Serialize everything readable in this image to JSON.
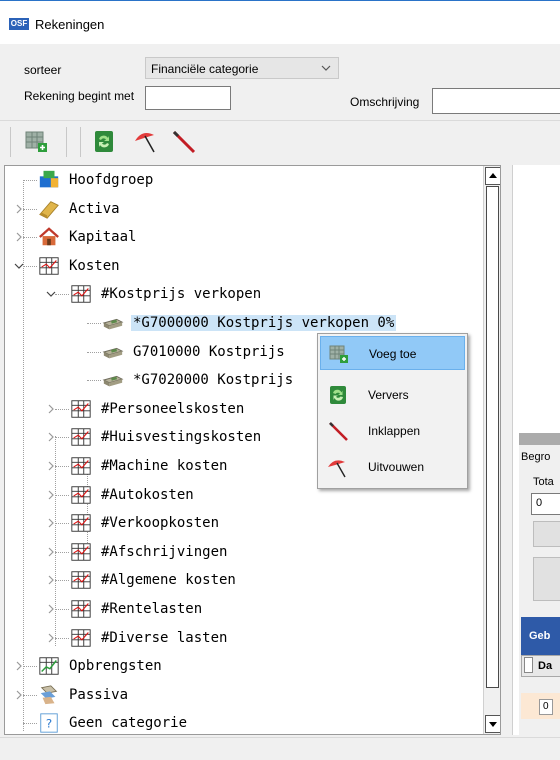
{
  "window": {
    "title": "Rekeningen",
    "app_icon_text": "OSF"
  },
  "filters": {
    "sort_label": "sorteer",
    "sort_value": "Financiële categorie",
    "start_label": "Rekening begint met",
    "start_value": "",
    "desc_label": "Omschrijving",
    "desc_value": ""
  },
  "toolbar": {
    "items": [
      {
        "name": "add-account-icon"
      },
      {
        "name": "refresh-icon"
      },
      {
        "name": "expand-umbrella-icon"
      },
      {
        "name": "collapse-icon"
      }
    ]
  },
  "tree": {
    "nodes": [
      {
        "label": "Hoofdgroep",
        "level": 0,
        "expander": "none",
        "icon": "hoofdgroep-icon"
      },
      {
        "label": "Activa",
        "level": 0,
        "expander": "collapsed",
        "icon": "gold-bar-icon"
      },
      {
        "label": "Kapitaal",
        "level": 0,
        "expander": "collapsed",
        "icon": "house-icon"
      },
      {
        "label": "Kosten",
        "level": 0,
        "expander": "expanded",
        "icon": "chart-table-icon"
      },
      {
        "label": "#Kostprijs verkopen",
        "level": 1,
        "expander": "expanded",
        "icon": "chart-table-icon"
      },
      {
        "label": "*G7000000 Kostprijs verkopen 0%",
        "level": 2,
        "expander": "none",
        "icon": "money-stack-icon",
        "selected": true
      },
      {
        "label": "G7010000 Kostprijs",
        "level": 2,
        "expander": "none",
        "icon": "money-stack-icon"
      },
      {
        "label": "*G7020000 Kostprijs",
        "level": 2,
        "expander": "none",
        "icon": "money-stack-icon"
      },
      {
        "label": "#Personeelskosten",
        "level": 1,
        "expander": "collapsed",
        "icon": "chart-table-icon"
      },
      {
        "label": "#Huisvestingskosten",
        "level": 1,
        "expander": "collapsed",
        "icon": "chart-table-icon"
      },
      {
        "label": "#Machine kosten",
        "level": 1,
        "expander": "collapsed",
        "icon": "chart-table-icon"
      },
      {
        "label": "#Autokosten",
        "level": 1,
        "expander": "collapsed",
        "icon": "chart-table-icon"
      },
      {
        "label": "#Verkoopkosten",
        "level": 1,
        "expander": "collapsed",
        "icon": "chart-table-icon"
      },
      {
        "label": "#Afschrijvingen",
        "level": 1,
        "expander": "collapsed",
        "icon": "chart-table-icon"
      },
      {
        "label": "#Algemene kosten",
        "level": 1,
        "expander": "collapsed",
        "icon": "chart-table-icon"
      },
      {
        "label": "#Rentelasten",
        "level": 1,
        "expander": "collapsed",
        "icon": "chart-table-icon"
      },
      {
        "label": "#Diverse lasten",
        "level": 1,
        "expander": "collapsed",
        "icon": "chart-table-icon"
      },
      {
        "label": "Opbrengsten",
        "level": 0,
        "expander": "collapsed",
        "icon": "revenue-chart-icon"
      },
      {
        "label": "Passiva",
        "level": 0,
        "expander": "collapsed",
        "icon": "passiva-icon"
      },
      {
        "label": "Geen categorie",
        "level": 0,
        "expander": "none",
        "icon": "question-icon"
      }
    ]
  },
  "context_menu": {
    "items": [
      {
        "label": "Voeg toe",
        "icon": "add-account-icon",
        "highlighted": true
      },
      {
        "label": "Ververs",
        "icon": "refresh-icon",
        "highlighted": false
      },
      {
        "label": "Inklappen",
        "icon": "collapse-icon",
        "highlighted": false
      },
      {
        "label": "Uitvouwen",
        "icon": "expand-umbrella-icon",
        "highlighted": false
      }
    ]
  },
  "right_panel": {
    "begro_label": "Begro",
    "tota_label": "Tota",
    "tota_value": "0",
    "table_header": "Geb",
    "col_header": "Da",
    "row_value": "0"
  },
  "colors": {
    "selection": "#cce4f7",
    "menu_highlight": "#91c9f7",
    "panel_header": "#2e5aa8"
  }
}
